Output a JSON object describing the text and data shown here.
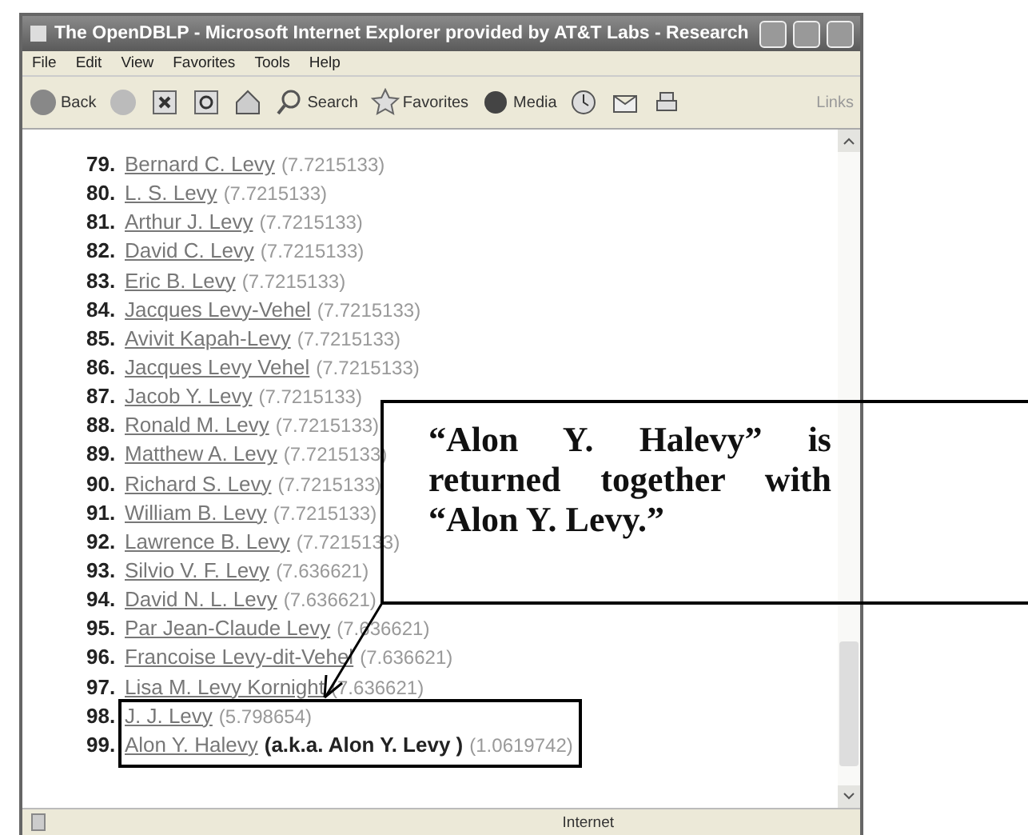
{
  "window": {
    "title": "The OpenDBLP - Microsoft Internet Explorer provided by AT&T Labs - Research"
  },
  "menu": [
    "File",
    "Edit",
    "View",
    "Favorites",
    "Tools",
    "Help"
  ],
  "toolbar": [
    {
      "kind": "back",
      "label": "Back"
    },
    {
      "kind": "forward"
    },
    {
      "kind": "stop"
    },
    {
      "kind": "refresh"
    },
    {
      "kind": "home"
    },
    {
      "kind": "search",
      "label": "Search"
    },
    {
      "kind": "favorites",
      "label": "Favorites"
    },
    {
      "kind": "media",
      "label": "Media"
    },
    {
      "kind": "history"
    },
    {
      "kind": "mail"
    },
    {
      "kind": "print"
    }
  ],
  "links_label": "Links",
  "results": [
    {
      "number": "79.",
      "name": "Bernard C. Levy",
      "score": "(7.7215133)"
    },
    {
      "number": "80.",
      "name": "L. S. Levy",
      "score": "(7.7215133)"
    },
    {
      "number": "81.",
      "name": "Arthur J. Levy",
      "score": "(7.7215133)"
    },
    {
      "number": "82.",
      "name": "David C. Levy",
      "score": "(7.7215133)"
    },
    {
      "number": "83.",
      "name": "Eric B. Levy",
      "score": "(7.7215133)"
    },
    {
      "number": "84.",
      "name": "Jacques Levy-Vehel",
      "score": "(7.7215133)"
    },
    {
      "number": "85.",
      "name": "Avivit Kapah-Levy",
      "score": "(7.7215133)"
    },
    {
      "number": "86.",
      "name": "Jacques Levy Vehel",
      "score": "(7.7215133)"
    },
    {
      "number": "87.",
      "name": "Jacob Y. Levy",
      "score": "(7.7215133)"
    },
    {
      "number": "88.",
      "name": "Ronald M. Levy",
      "score": "(7.7215133)"
    },
    {
      "number": "89.",
      "name": "Matthew A. Levy",
      "score": "(7.7215133)"
    },
    {
      "number": "90.",
      "name": "Richard S. Levy",
      "score": "(7.7215133)"
    },
    {
      "number": "91.",
      "name": "William B. Levy",
      "score": "(7.7215133)"
    },
    {
      "number": "92.",
      "name": "Lawrence B. Levy",
      "score": "(7.7215133)"
    },
    {
      "number": "93.",
      "name": "Silvio V. F. Levy",
      "score": "(7.636621)"
    },
    {
      "number": "94.",
      "name": "David N. L. Levy",
      "score": "(7.636621)"
    },
    {
      "number": "95.",
      "name": "Par Jean-Claude Levy",
      "score": "(7.636621)"
    },
    {
      "number": "96.",
      "name": "Francoise Levy-dit-Vehel",
      "score": "(7.636621)"
    },
    {
      "number": "97.",
      "name": "Lisa M. Levy Kornight",
      "score": "(7.636621)"
    },
    {
      "number": "98.",
      "name": "J. J. Levy",
      "score": "(5.798654)"
    },
    {
      "number": "99.",
      "name": "Alon Y. Halevy",
      "note": "(a.k.a. Alon Y. Levy )",
      "score": "(1.0619742)"
    }
  ],
  "status_bar": {
    "zone": "Internet"
  },
  "callout": {
    "text": "“Alon Y. Halevy” is returned together with “Alon Y. Levy.”"
  }
}
